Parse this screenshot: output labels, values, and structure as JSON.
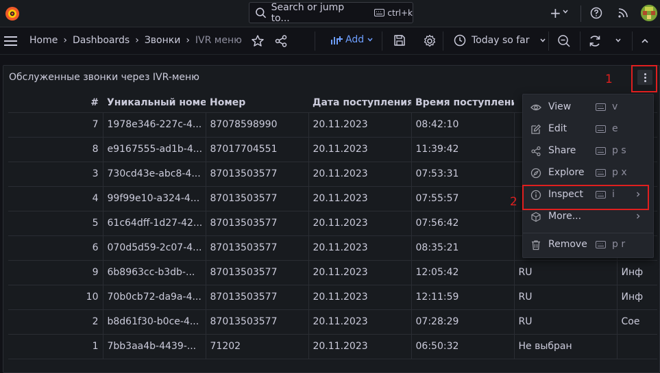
{
  "topbar": {
    "search_text": "Search or jump to...",
    "search_shortcut": "ctrl+k"
  },
  "nav": {
    "breadcrumbs": [
      "Home",
      "Dashboards",
      "Звонки",
      "IVR меню"
    ],
    "add_label": "Add",
    "time_range": "Today so far"
  },
  "panel": {
    "title": "Обслуженные звонки через IVR-меню",
    "columns": [
      "#",
      "Уникальный номер",
      "Номер",
      "Дата поступления з",
      "Время поступления",
      "",
      ""
    ],
    "rows": [
      [
        "7",
        "1978e346-227c-4...",
        "87078598990",
        "20.11.2023",
        "08:42:10",
        "",
        ""
      ],
      [
        "8",
        "e9167555-ad1b-4...",
        "87017704551",
        "20.11.2023",
        "11:39:42",
        "",
        ""
      ],
      [
        "3",
        "730cd43e-abc8-4...",
        "87013503577",
        "20.11.2023",
        "07:53:31",
        "",
        ""
      ],
      [
        "4",
        "99f99e10-a324-4...",
        "87013503577",
        "20.11.2023",
        "07:55:57",
        "",
        ""
      ],
      [
        "5",
        "61c64dff-1d27-42...",
        "87013503577",
        "20.11.2023",
        "07:56:42",
        "",
        ""
      ],
      [
        "6",
        "070d5d59-2c07-4...",
        "87013503577",
        "20.11.2023",
        "08:35:21",
        "",
        ""
      ],
      [
        "9",
        "6b8963cc-b3db-...",
        "87013503577",
        "20.11.2023",
        "12:05:42",
        "RU",
        "Инф"
      ],
      [
        "10",
        "70b0cb72-da9a-4...",
        "87013503577",
        "20.11.2023",
        "12:11:59",
        "RU",
        "Инф"
      ],
      [
        "2",
        "b8d61f30-b0ce-4...",
        "87013503577",
        "20.11.2023",
        "07:28:29",
        "RU",
        "Сое"
      ],
      [
        "1",
        "7bb3aa4b-4439-...",
        "71202",
        "20.11.2023",
        "06:50:32",
        "Не выбран",
        ""
      ]
    ]
  },
  "menu": {
    "items": [
      {
        "label": "View",
        "key": "v",
        "icon": "eye-icon"
      },
      {
        "label": "Edit",
        "key": "e",
        "icon": "edit-icon"
      },
      {
        "label": "Share",
        "key": "p s",
        "icon": "share-icon"
      },
      {
        "label": "Explore",
        "key": "p x",
        "icon": "compass-icon"
      },
      {
        "label": "Inspect",
        "key": "i",
        "icon": "info-icon"
      },
      {
        "label": "More...",
        "key": "",
        "icon": "cube-icon"
      },
      {
        "label": "Remove",
        "key": "p r",
        "icon": "trash-icon"
      }
    ]
  },
  "annotations": {
    "marker_1": "1",
    "marker_2": "2"
  },
  "colors": {
    "accent": "#6e9fff",
    "highlight": "#e01f1f",
    "panel_bg": "#181b1f",
    "page_bg": "#111217"
  }
}
